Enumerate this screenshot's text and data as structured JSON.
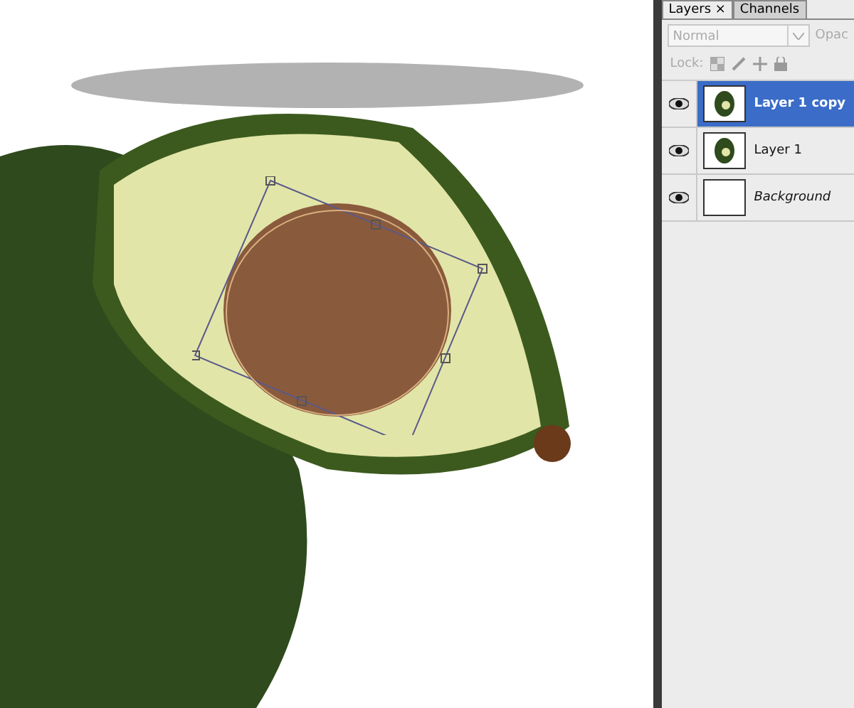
{
  "canvas": {
    "transform": {
      "active": true
    }
  },
  "layers_panel": {
    "tabs": [
      {
        "label": "Layers ×",
        "selected": true
      },
      {
        "label": "Channels",
        "selected": false
      }
    ],
    "blend_mode": {
      "value": "Normal"
    },
    "opacity_label": "Opac",
    "lock_label": "Lock:",
    "layers": [
      {
        "name": "Layer 1 copy",
        "kind": "layer",
        "visible": true,
        "selected": true
      },
      {
        "name": "Layer 1",
        "kind": "layer",
        "visible": true,
        "selected": false
      },
      {
        "name": "Background",
        "kind": "background",
        "visible": true,
        "selected": false
      }
    ]
  }
}
